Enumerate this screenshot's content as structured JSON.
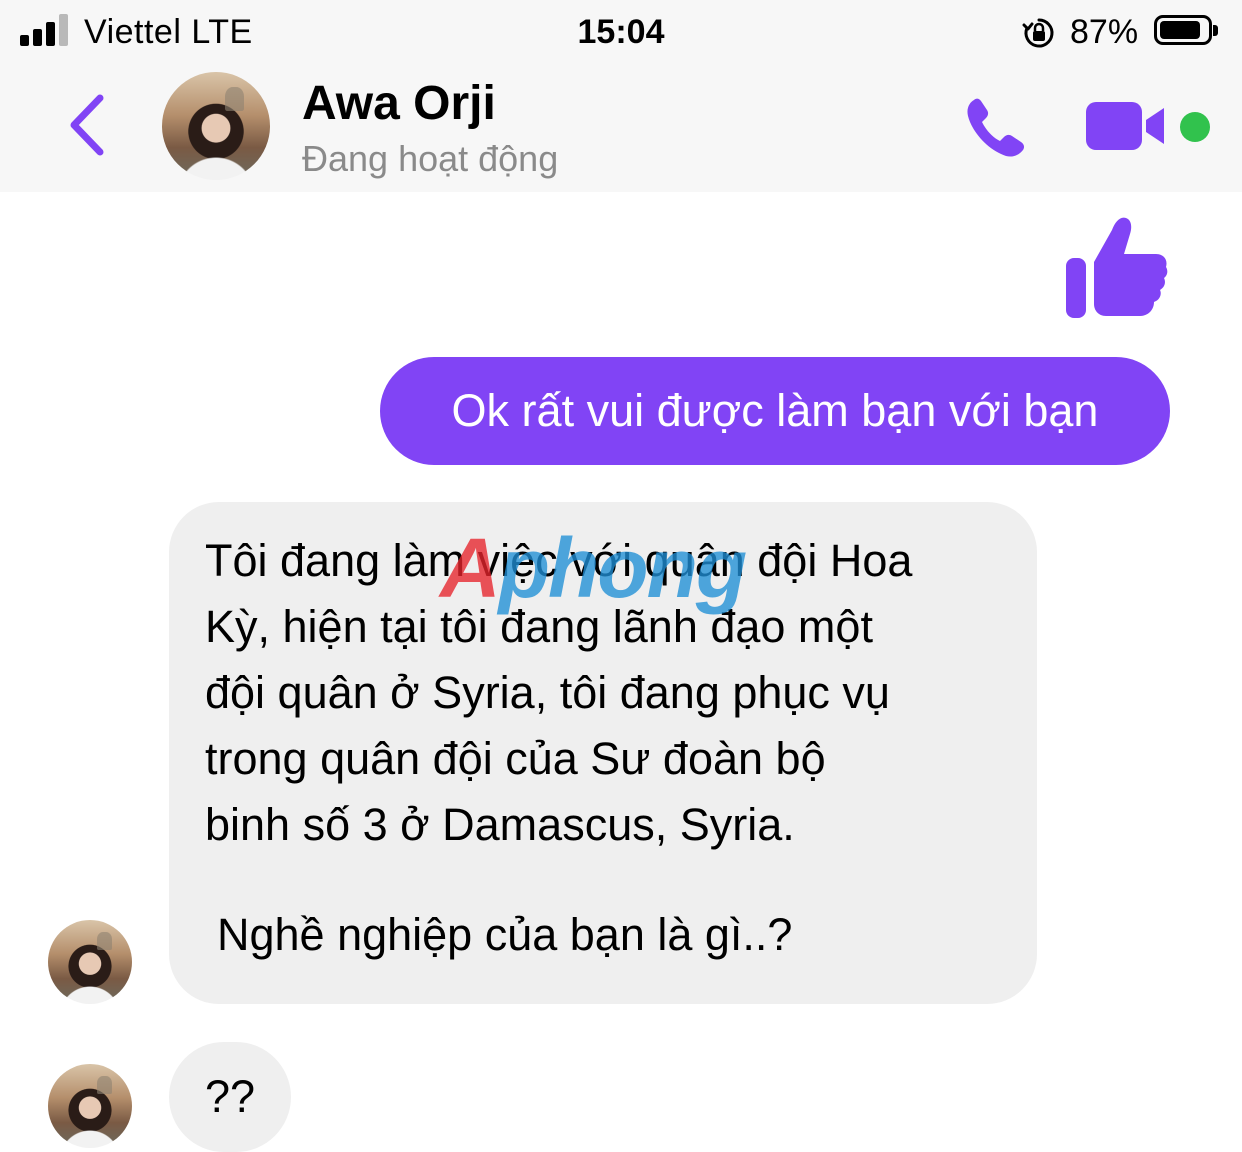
{
  "status_bar": {
    "carrier": "Viettel   LTE",
    "time": "15:04",
    "battery_percent": "87%",
    "signal_bars": 4,
    "signal_bars_filled": 3,
    "battery_level": 0.87
  },
  "header": {
    "contact_name": "Awa Orji",
    "contact_status": "Đang hoạt động",
    "accent_color": "#8144f5",
    "online_color": "#31c24d",
    "icons": [
      "back-chevron-icon",
      "phone-icon",
      "video-camera-icon"
    ]
  },
  "messages": {
    "like_icon": "thumbs-up-icon",
    "outgoing": {
      "text": "Ok rất vui được làm bạn với bạn"
    },
    "incoming_long": {
      "lines": [
        "Tôi đang làm việc với quân đội Hoa",
        "Kỳ, hiện tại tôi đang lãnh đạo một",
        "đội quân ở Syria, tôi đang phục vụ",
        "trong quân đội của Sư đoàn bộ",
        "binh số 3 ở Damascus, Syria."
      ],
      "question": "Nghề nghiệp của bạn là gì..?"
    },
    "incoming_short": {
      "text": "??"
    }
  },
  "watermark": {
    "part1": "A",
    "part2": "phong"
  }
}
